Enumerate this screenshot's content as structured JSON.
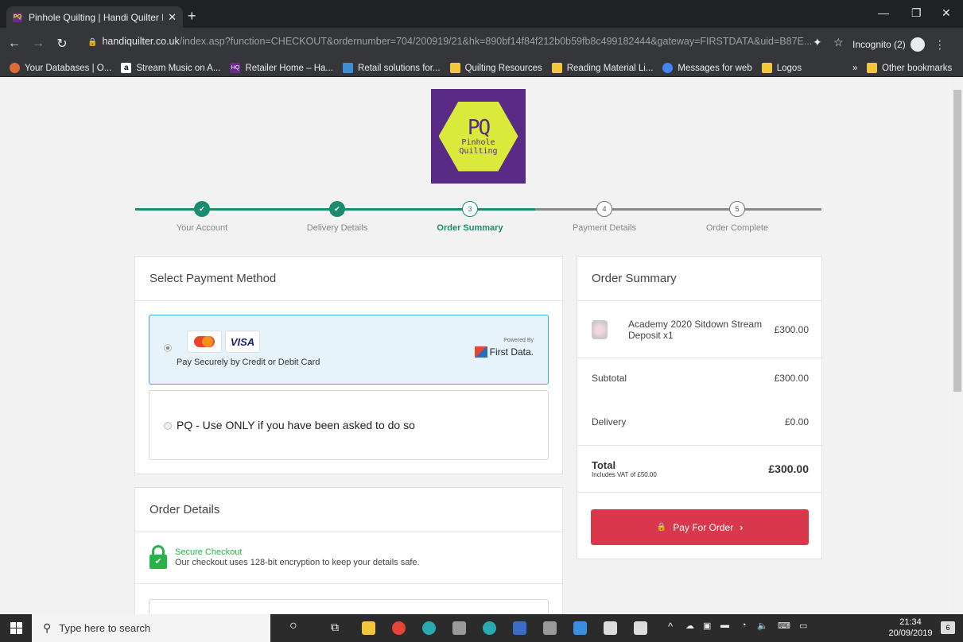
{
  "browser": {
    "tab_title": "Pinhole Quilting | Handi Quilter L",
    "tab_favicon": "PQ",
    "url_domain": "handiquilter.co.uk",
    "url_path": "/index.asp?function=CHECKOUT&ordernumber=704/200919/21&hk=890bf14f84f212b0b59fb8c499182444&gateway=FIRSTDATA&uid=B87E...",
    "incognito_label": "Incognito (2)"
  },
  "bookmarks": [
    {
      "label": "Your Databases | O...",
      "color": "#e06a3a"
    },
    {
      "label": "Stream Music on A...",
      "color": "#ffffff"
    },
    {
      "label": "Retailer Home – Ha...",
      "color": "#6a2b8c",
      "icon_text": "HQ"
    },
    {
      "label": "Retail solutions for...",
      "color": "#3d8fd6"
    },
    {
      "label": "Quilting Resources",
      "color": "#f4c63d"
    },
    {
      "label": "Reading Material Li...",
      "color": "#f4c63d"
    },
    {
      "label": "Messages for web",
      "color": "#4285f4"
    },
    {
      "label": "Logos",
      "color": "#f4c63d"
    }
  ],
  "bookmarks_overflow": "»",
  "bookmarks_other": "Other bookmarks",
  "logo": {
    "initials": "PQ",
    "name_line1": "Pinhole",
    "name_line2": "Quilting"
  },
  "steps": [
    {
      "num": "1",
      "label": "Your Account",
      "state": "done"
    },
    {
      "num": "2",
      "label": "Delivery Details",
      "state": "done"
    },
    {
      "num": "3",
      "label": "Order Summary",
      "state": "current"
    },
    {
      "num": "4",
      "label": "Payment Details",
      "state": "todo"
    },
    {
      "num": "5",
      "label": "Order Complete",
      "state": "todo"
    }
  ],
  "payment": {
    "heading": "Select Payment Method",
    "option1": {
      "mastercard": "MasterCard",
      "visa": "VISA",
      "label": "Pay Securely by Credit or Debit Card",
      "powered": "Powered By",
      "provider": "First Data."
    },
    "option2": {
      "label": "PQ - Use ONLY if you have been asked to do so"
    }
  },
  "order_details": {
    "heading": "Order Details",
    "secure_title": "Secure Checkout",
    "secure_text": "Our checkout uses 128-bit encryption to keep your details safe."
  },
  "summary": {
    "heading": "Order Summary",
    "item_name": "Academy 2020 Sitdown Stream Deposit x1",
    "item_price": "£300.00",
    "subtotal_label": "Subtotal",
    "subtotal": "£300.00",
    "delivery_label": "Delivery",
    "delivery": "£0.00",
    "total_label": "Total",
    "vat_note": "Includes VAT of £50.00",
    "total": "£300.00",
    "pay_button": "Pay For Order"
  },
  "taskbar": {
    "search_placeholder": "Type here to search",
    "time": "21:34",
    "date": "20/09/2019",
    "notifications": "6"
  },
  "colors": {
    "accent": "#1c8c6e",
    "pay": "#d9384c",
    "selected_border": "#3ea8d8"
  }
}
